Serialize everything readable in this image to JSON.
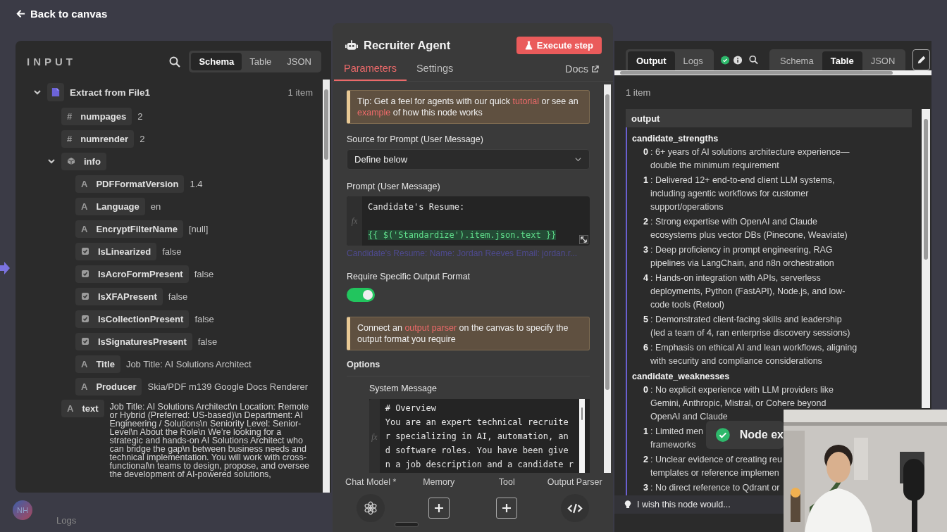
{
  "back_link": {
    "label": "Back to canvas"
  },
  "canvas": {
    "avatar": "NH",
    "logs_label": "Logs"
  },
  "input_panel": {
    "title": "INPUT",
    "view_tabs": [
      {
        "label": "Schema",
        "selected": true
      },
      {
        "label": "Table",
        "selected": false
      },
      {
        "label": "JSON",
        "selected": false
      }
    ],
    "tree": [
      {
        "kind": "node",
        "key": "Extract from File1",
        "count": "1 item",
        "expanded": true,
        "children": [
          {
            "kind": "number",
            "glyph": "#",
            "key": "numpages",
            "value": "2"
          },
          {
            "kind": "number",
            "glyph": "#",
            "key": "numrender",
            "value": "2"
          },
          {
            "kind": "object",
            "key": "info",
            "expanded": true,
            "children": [
              {
                "kind": "string",
                "glyph": "A",
                "key": "PDFFormatVersion",
                "value": "1.4"
              },
              {
                "kind": "string",
                "glyph": "A",
                "key": "Language",
                "value": "en"
              },
              {
                "kind": "string",
                "glyph": "A",
                "key": "EncryptFilterName",
                "value": "[null]"
              },
              {
                "kind": "boolean",
                "key": "IsLinearized",
                "value": "false"
              },
              {
                "kind": "boolean",
                "key": "IsAcroFormPresent",
                "value": "false"
              },
              {
                "kind": "boolean",
                "key": "IsXFAPresent",
                "value": "false"
              },
              {
                "kind": "boolean",
                "key": "IsCollectionPresent",
                "value": "false"
              },
              {
                "kind": "boolean",
                "key": "IsSignaturesPresent",
                "value": "false"
              },
              {
                "kind": "string",
                "glyph": "A",
                "key": "Title",
                "value": "Job Title: AI Solutions Architect"
              },
              {
                "kind": "string",
                "glyph": "A",
                "key": "Producer",
                "value": "Skia/PDF m139 Google Docs Renderer"
              }
            ]
          },
          {
            "kind": "string",
            "glyph": "A",
            "key": "text",
            "value": "Job Title: AI Solutions Architect\\n Location: Remote or Hybrid (Preferred: US-based)\\n Department: AI Engineering / Solutions\\n Seniority Level: Senior-Level\\n About the Role\\n We’re looking for a strategic and hands-on AI Solutions Architect who can bridge the gap\\n between business needs and technical implementation. You will work with cross-functional\\n teams to design, propose, and oversee the development of AI-powered solutions,"
          }
        ]
      }
    ]
  },
  "node_panel": {
    "title": "Recruiter Agent",
    "execute_button": "Execute step",
    "tabs": [
      {
        "label": "Parameters",
        "selected": true
      },
      {
        "label": "Settings",
        "selected": false
      }
    ],
    "docs_link": "Docs",
    "tip": [
      {
        "text": "Tip: Get a feel for agents with our quick "
      },
      {
        "text": "tutorial",
        "link": true
      },
      {
        "text": " or see an "
      },
      {
        "text": "example",
        "link": true
      },
      {
        "text": " of how this node works"
      }
    ],
    "source_label": "Source for Prompt (User Message)",
    "source_value": "Define below",
    "prompt_label": "Prompt (User Message)",
    "prompt_gutter": "fx",
    "prompt_lines": [
      {
        "kind": "plain",
        "text": "Candidate's Resume:"
      },
      {
        "kind": "blank"
      },
      {
        "kind": "expression",
        "text": "{{ $('Standardize').item.json.text }}"
      }
    ],
    "prompt_preview": "Candidate's Resume: Name: Jordan Reeves Email: jordan.r...",
    "output_format_label": "Require Specific Output Format",
    "output_format_on": true,
    "parser_notice": [
      {
        "text": "Connect an "
      },
      {
        "text": "output parser",
        "link": true
      },
      {
        "text": " on the canvas to specify the output format you require"
      }
    ],
    "options_label": "Options",
    "system_message_label": "System Message",
    "system_gutter": "fx",
    "system_message_lines": [
      "# Overview",
      "You are an expert technical recruite",
      "r specializing in AI, automation, an",
      "d software roles. You have been give",
      "n a job description and a candidate r"
    ],
    "connectors": [
      {
        "label": "Chat Model *",
        "kind": "model"
      },
      {
        "label": "Memory",
        "kind": "add"
      },
      {
        "label": "Tool",
        "kind": "add"
      },
      {
        "label": "Output Parser",
        "kind": "parser"
      }
    ]
  },
  "output_panel": {
    "tabs": [
      {
        "label": "Output",
        "selected": true
      },
      {
        "label": "Logs",
        "selected": false
      }
    ],
    "view_tabs": [
      {
        "label": "Schema",
        "selected": false
      },
      {
        "label": "Table",
        "selected": true
      },
      {
        "label": "JSON",
        "selected": false
      }
    ],
    "item_count": "1 item",
    "column": "output",
    "groups": [
      {
        "key": "candidate_strengths",
        "items": [
          {
            "index": "0",
            "lines": [
              ": 6+ years of AI solutions architecture experience—",
              "double the minimum requirement"
            ]
          },
          {
            "index": "1",
            "lines": [
              ": Delivered 12+ end-to-end client LLM systems,",
              "including agentic workflows for customer",
              "support/operations"
            ]
          },
          {
            "index": "2",
            "lines": [
              ": Strong expertise with OpenAI and Claude",
              "ecosystems plus vector DBs (Pinecone, Weaviate)"
            ]
          },
          {
            "index": "3",
            "lines": [
              ": Deep proficiency in prompt engineering, RAG",
              "pipelines via LangChain, and n8n orchestration"
            ]
          },
          {
            "index": "4",
            "lines": [
              ": Hands-on integration with APIs, serverless",
              "deployments, Python (FastAPI), Node.js, and low-",
              "code tools (Retool)"
            ]
          },
          {
            "index": "5",
            "lines": [
              ": Demonstrated client-facing skills and leadership",
              "(led a team of 4, ran enterprise discovery sessions)"
            ]
          },
          {
            "index": "6",
            "lines": [
              ": Emphasis on ethical AI and lean workflows, aligning",
              "with security and compliance considerations"
            ]
          }
        ]
      },
      {
        "key": "candidate_weaknesses",
        "items": [
          {
            "index": "0",
            "lines": [
              ": No explicit experience with LLM providers like",
              "Gemini, Anthropic, Mistral, or Cohere beyond",
              "OpenAI and Claude"
            ]
          },
          {
            "index": "1",
            "lines": [
              ": Limited men",
              "frameworks"
            ]
          },
          {
            "index": "2",
            "lines": [
              ": Unclear evidence of creating reu",
              "templates or reference implemen"
            ]
          },
          {
            "index": "3",
            "lines": [
              ": No direct reference to Qdrant or"
            ]
          }
        ]
      }
    ],
    "feedback": "I wish this node would..."
  },
  "toast": {
    "message": "Node ex"
  }
}
